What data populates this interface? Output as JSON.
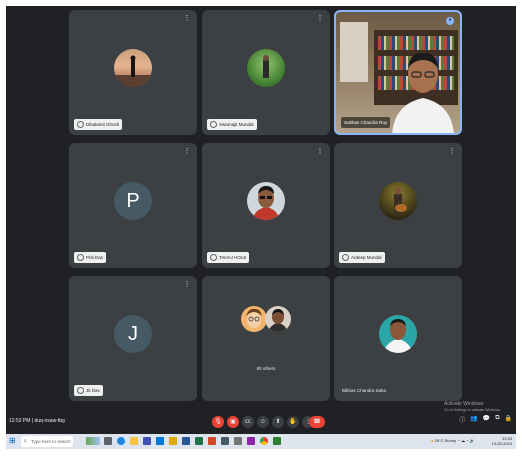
{
  "tiles": [
    {
      "name": "Dibakanti Ghosh"
    },
    {
      "name": "Swarnajit Mondal"
    },
    {
      "name": "Subhas Chandra Roy"
    },
    {
      "name": "Priti Das",
      "letter": "P"
    },
    {
      "name": "TAHAJ HOLE"
    },
    {
      "name": "Ardeep Mondal"
    },
    {
      "name": "Jit Das",
      "letter": "J"
    },
    {
      "name": "80 others"
    },
    {
      "name": "Bibhas Chandra Saha"
    }
  ],
  "meeting": {
    "time": "12:53 PM",
    "separator": "|",
    "code": "duq-nsaw-tbg"
  },
  "activation": {
    "title": "Activate Windows",
    "subtitle": "Go to Settings to activate Windows."
  },
  "taskbar": {
    "search_placeholder": "Type here to search",
    "weather": "29°C Sunny",
    "clock_time": "12:53",
    "clock_date": "13-09-2024"
  },
  "colors": {
    "accent": "#8ab4f8",
    "end_call": "#ea4335",
    "background": "#202124",
    "tile": "#3c4043"
  }
}
